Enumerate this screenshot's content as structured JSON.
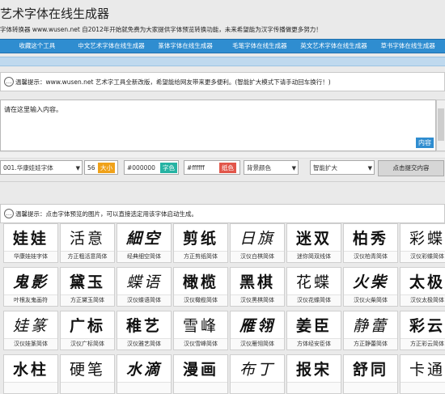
{
  "header": {
    "title": "艺术字体在线生成器",
    "subtitle": "字体转换器 www.wusen.net 自2012年开始就免费为大家提供字体预览转换功能，未来希望能为汉字传播做更多努力！"
  },
  "nav": {
    "items": [
      "收藏这个工具",
      "中文艺术字体在线生成器",
      "篆体字体在线生成器",
      "毛笔字体在线生成器",
      "英文艺术字体在线生成器",
      "草书字体在线生成器"
    ]
  },
  "notice1": "温馨提示：www.wusen.net 艺术字工具全新改版，希望能给网友带来更多便利。(智能扩大模式下请手动回车换行！)",
  "editor": {
    "value": "请在这里输入内容。",
    "expand_label": "内容"
  },
  "controls": {
    "font_select": "001.华康娃娃字体",
    "size_value": "56",
    "size_label": "大小",
    "color_value": "#000000",
    "color_label": "字色",
    "bg_value": "#ffffff",
    "bg_label": "纸色",
    "background_select": "背景颜色",
    "mode_select": "智能扩大",
    "submit_label": "点击提交内容"
  },
  "colors": {
    "nav_bg": "#2f8dd0",
    "size_badge": "#f0a21a",
    "color_badge": "#26b3a3",
    "bg_badge": "#e2564a"
  },
  "notice2": "温馨提示：点击字体预览的图片，可以直接选定用该字体启动生成。",
  "font_cards": [
    {
      "glyphs": "娃娃",
      "label": "华康娃娃字体"
    },
    {
      "glyphs": "活意",
      "label": "方正粗活意简体"
    },
    {
      "glyphs": "細空",
      "label": "经典细空简体"
    },
    {
      "glyphs": "剪纸",
      "label": "方正剪纸简体"
    },
    {
      "glyphs": "日旗",
      "label": "汉仪白棋简体"
    },
    {
      "glyphs": "迷双",
      "label": "迷你简双线体"
    },
    {
      "glyphs": "柏秀",
      "label": "汉仪柏青简体"
    },
    {
      "glyphs": "彩蝶",
      "label": "汉仪彩蝶简体"
    },
    {
      "glyphs": "鬼影",
      "label": "叶根友鬼画符"
    },
    {
      "glyphs": "黛玉",
      "label": "方正黛玉简体"
    },
    {
      "glyphs": "蝶语",
      "label": "汉仪蝶语简体"
    },
    {
      "glyphs": "橄榄",
      "label": "汉仪橄榄简体"
    },
    {
      "glyphs": "黑棋",
      "label": "汉仪黑棋简体"
    },
    {
      "glyphs": "花蝶",
      "label": "汉仪花蝶简体"
    },
    {
      "glyphs": "火柴",
      "label": "汉仪火柴简体"
    },
    {
      "glyphs": "太极",
      "label": "汉仪太极简体"
    },
    {
      "glyphs": "娃篆",
      "label": "汉仪娃篆简体"
    },
    {
      "glyphs": "广标",
      "label": "汉仪广标简体"
    },
    {
      "glyphs": "稚艺",
      "label": "汉仪雅艺简体"
    },
    {
      "glyphs": "雪峰",
      "label": "汉仪雪峰简体"
    },
    {
      "glyphs": "雁翎",
      "label": "汉仪雁翎简体"
    },
    {
      "glyphs": "姜臣",
      "label": "方体经安臣体"
    },
    {
      "glyphs": "静蕾",
      "label": "方正静蕾简体"
    },
    {
      "glyphs": "彩云",
      "label": "方正彩云简体"
    },
    {
      "glyphs": "水柱",
      "label": ""
    },
    {
      "glyphs": "硬笔",
      "label": ""
    },
    {
      "glyphs": "水滴",
      "label": ""
    },
    {
      "glyphs": "漫画",
      "label": ""
    },
    {
      "glyphs": "布丁",
      "label": ""
    },
    {
      "glyphs": "报宋",
      "label": ""
    },
    {
      "glyphs": "舒同",
      "label": ""
    },
    {
      "glyphs": "卡通",
      "label": ""
    }
  ]
}
